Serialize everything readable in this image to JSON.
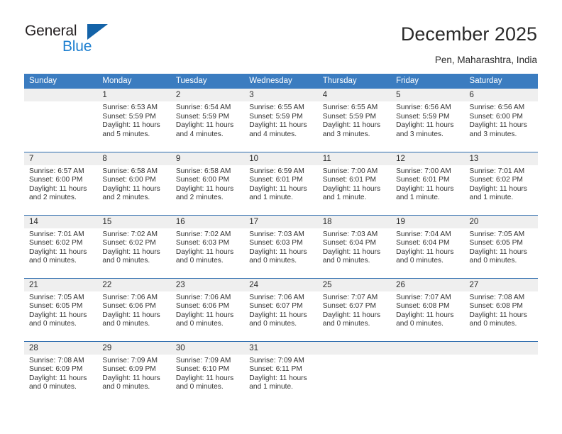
{
  "brand": {
    "name_part1": "General",
    "name_part2": "Blue",
    "triangle_icon": "triangle-icon",
    "accent_dark": "#1463a8",
    "accent_light": "#1d7fd0"
  },
  "header": {
    "title": "December 2025",
    "subtitle": "Pen, Maharashtra, India"
  },
  "theme": {
    "header_row_bg": "#3b7cc0",
    "row_separator": "#2a6aad",
    "daynum_band_bg": "#efefef",
    "text": "#333333"
  },
  "weekday_headers": [
    "Sunday",
    "Monday",
    "Tuesday",
    "Wednesday",
    "Thursday",
    "Friday",
    "Saturday"
  ],
  "labels": {
    "sunrise_prefix": "Sunrise:",
    "sunset_prefix": "Sunset:",
    "daylight_prefix": "Daylight:"
  },
  "weeks": [
    [
      {
        "day": "",
        "sunrise": "",
        "sunset": "",
        "daylight_line1": "",
        "daylight_line2": ""
      },
      {
        "day": "1",
        "sunrise": "Sunrise: 6:53 AM",
        "sunset": "Sunset: 5:59 PM",
        "daylight_line1": "Daylight: 11 hours",
        "daylight_line2": "and 5 minutes."
      },
      {
        "day": "2",
        "sunrise": "Sunrise: 6:54 AM",
        "sunset": "Sunset: 5:59 PM",
        "daylight_line1": "Daylight: 11 hours",
        "daylight_line2": "and 4 minutes."
      },
      {
        "day": "3",
        "sunrise": "Sunrise: 6:55 AM",
        "sunset": "Sunset: 5:59 PM",
        "daylight_line1": "Daylight: 11 hours",
        "daylight_line2": "and 4 minutes."
      },
      {
        "day": "4",
        "sunrise": "Sunrise: 6:55 AM",
        "sunset": "Sunset: 5:59 PM",
        "daylight_line1": "Daylight: 11 hours",
        "daylight_line2": "and 3 minutes."
      },
      {
        "day": "5",
        "sunrise": "Sunrise: 6:56 AM",
        "sunset": "Sunset: 5:59 PM",
        "daylight_line1": "Daylight: 11 hours",
        "daylight_line2": "and 3 minutes."
      },
      {
        "day": "6",
        "sunrise": "Sunrise: 6:56 AM",
        "sunset": "Sunset: 6:00 PM",
        "daylight_line1": "Daylight: 11 hours",
        "daylight_line2": "and 3 minutes."
      }
    ],
    [
      {
        "day": "7",
        "sunrise": "Sunrise: 6:57 AM",
        "sunset": "Sunset: 6:00 PM",
        "daylight_line1": "Daylight: 11 hours",
        "daylight_line2": "and 2 minutes."
      },
      {
        "day": "8",
        "sunrise": "Sunrise: 6:58 AM",
        "sunset": "Sunset: 6:00 PM",
        "daylight_line1": "Daylight: 11 hours",
        "daylight_line2": "and 2 minutes."
      },
      {
        "day": "9",
        "sunrise": "Sunrise: 6:58 AM",
        "sunset": "Sunset: 6:00 PM",
        "daylight_line1": "Daylight: 11 hours",
        "daylight_line2": "and 2 minutes."
      },
      {
        "day": "10",
        "sunrise": "Sunrise: 6:59 AM",
        "sunset": "Sunset: 6:01 PM",
        "daylight_line1": "Daylight: 11 hours",
        "daylight_line2": "and 1 minute."
      },
      {
        "day": "11",
        "sunrise": "Sunrise: 7:00 AM",
        "sunset": "Sunset: 6:01 PM",
        "daylight_line1": "Daylight: 11 hours",
        "daylight_line2": "and 1 minute."
      },
      {
        "day": "12",
        "sunrise": "Sunrise: 7:00 AM",
        "sunset": "Sunset: 6:01 PM",
        "daylight_line1": "Daylight: 11 hours",
        "daylight_line2": "and 1 minute."
      },
      {
        "day": "13",
        "sunrise": "Sunrise: 7:01 AM",
        "sunset": "Sunset: 6:02 PM",
        "daylight_line1": "Daylight: 11 hours",
        "daylight_line2": "and 1 minute."
      }
    ],
    [
      {
        "day": "14",
        "sunrise": "Sunrise: 7:01 AM",
        "sunset": "Sunset: 6:02 PM",
        "daylight_line1": "Daylight: 11 hours",
        "daylight_line2": "and 0 minutes."
      },
      {
        "day": "15",
        "sunrise": "Sunrise: 7:02 AM",
        "sunset": "Sunset: 6:02 PM",
        "daylight_line1": "Daylight: 11 hours",
        "daylight_line2": "and 0 minutes."
      },
      {
        "day": "16",
        "sunrise": "Sunrise: 7:02 AM",
        "sunset": "Sunset: 6:03 PM",
        "daylight_line1": "Daylight: 11 hours",
        "daylight_line2": "and 0 minutes."
      },
      {
        "day": "17",
        "sunrise": "Sunrise: 7:03 AM",
        "sunset": "Sunset: 6:03 PM",
        "daylight_line1": "Daylight: 11 hours",
        "daylight_line2": "and 0 minutes."
      },
      {
        "day": "18",
        "sunrise": "Sunrise: 7:03 AM",
        "sunset": "Sunset: 6:04 PM",
        "daylight_line1": "Daylight: 11 hours",
        "daylight_line2": "and 0 minutes."
      },
      {
        "day": "19",
        "sunrise": "Sunrise: 7:04 AM",
        "sunset": "Sunset: 6:04 PM",
        "daylight_line1": "Daylight: 11 hours",
        "daylight_line2": "and 0 minutes."
      },
      {
        "day": "20",
        "sunrise": "Sunrise: 7:05 AM",
        "sunset": "Sunset: 6:05 PM",
        "daylight_line1": "Daylight: 11 hours",
        "daylight_line2": "and 0 minutes."
      }
    ],
    [
      {
        "day": "21",
        "sunrise": "Sunrise: 7:05 AM",
        "sunset": "Sunset: 6:05 PM",
        "daylight_line1": "Daylight: 11 hours",
        "daylight_line2": "and 0 minutes."
      },
      {
        "day": "22",
        "sunrise": "Sunrise: 7:06 AM",
        "sunset": "Sunset: 6:06 PM",
        "daylight_line1": "Daylight: 11 hours",
        "daylight_line2": "and 0 minutes."
      },
      {
        "day": "23",
        "sunrise": "Sunrise: 7:06 AM",
        "sunset": "Sunset: 6:06 PM",
        "daylight_line1": "Daylight: 11 hours",
        "daylight_line2": "and 0 minutes."
      },
      {
        "day": "24",
        "sunrise": "Sunrise: 7:06 AM",
        "sunset": "Sunset: 6:07 PM",
        "daylight_line1": "Daylight: 11 hours",
        "daylight_line2": "and 0 minutes."
      },
      {
        "day": "25",
        "sunrise": "Sunrise: 7:07 AM",
        "sunset": "Sunset: 6:07 PM",
        "daylight_line1": "Daylight: 11 hours",
        "daylight_line2": "and 0 minutes."
      },
      {
        "day": "26",
        "sunrise": "Sunrise: 7:07 AM",
        "sunset": "Sunset: 6:08 PM",
        "daylight_line1": "Daylight: 11 hours",
        "daylight_line2": "and 0 minutes."
      },
      {
        "day": "27",
        "sunrise": "Sunrise: 7:08 AM",
        "sunset": "Sunset: 6:08 PM",
        "daylight_line1": "Daylight: 11 hours",
        "daylight_line2": "and 0 minutes."
      }
    ],
    [
      {
        "day": "28",
        "sunrise": "Sunrise: 7:08 AM",
        "sunset": "Sunset: 6:09 PM",
        "daylight_line1": "Daylight: 11 hours",
        "daylight_line2": "and 0 minutes."
      },
      {
        "day": "29",
        "sunrise": "Sunrise: 7:09 AM",
        "sunset": "Sunset: 6:09 PM",
        "daylight_line1": "Daylight: 11 hours",
        "daylight_line2": "and 0 minutes."
      },
      {
        "day": "30",
        "sunrise": "Sunrise: 7:09 AM",
        "sunset": "Sunset: 6:10 PM",
        "daylight_line1": "Daylight: 11 hours",
        "daylight_line2": "and 0 minutes."
      },
      {
        "day": "31",
        "sunrise": "Sunrise: 7:09 AM",
        "sunset": "Sunset: 6:11 PM",
        "daylight_line1": "Daylight: 11 hours",
        "daylight_line2": "and 1 minute."
      },
      {
        "day": "",
        "sunrise": "",
        "sunset": "",
        "daylight_line1": "",
        "daylight_line2": ""
      },
      {
        "day": "",
        "sunrise": "",
        "sunset": "",
        "daylight_line1": "",
        "daylight_line2": ""
      },
      {
        "day": "",
        "sunrise": "",
        "sunset": "",
        "daylight_line1": "",
        "daylight_line2": ""
      }
    ]
  ]
}
